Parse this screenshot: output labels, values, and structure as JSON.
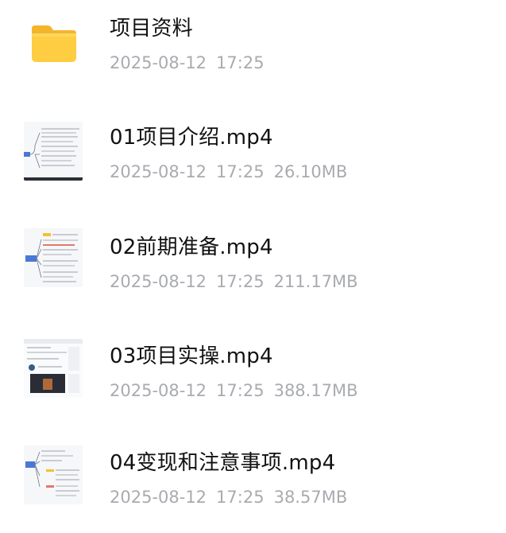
{
  "files": [
    {
      "name": "项目资料",
      "date": "2025-08-12",
      "time": "17:25",
      "size": "",
      "type": "folder",
      "icon": "folder-icon"
    },
    {
      "name": "01项目介绍.mp4",
      "date": "2025-08-12",
      "time": "17:25",
      "size": "26.10MB",
      "type": "video",
      "icon": "video-thumbnail"
    },
    {
      "name": "02前期准备.mp4",
      "date": "2025-08-12",
      "time": "17:25",
      "size": "211.17MB",
      "type": "video",
      "icon": "video-thumbnail"
    },
    {
      "name": "03项目实操.mp4",
      "date": "2025-08-12",
      "time": "17:25",
      "size": "388.17MB",
      "type": "video",
      "icon": "video-thumbnail"
    },
    {
      "name": "04变现和注意事项.mp4",
      "date": "2025-08-12",
      "time": "17:25",
      "size": "38.57MB",
      "type": "video",
      "icon": "video-thumbnail"
    }
  ],
  "colors": {
    "folder": "#ffcb3d",
    "name_text": "#111111",
    "meta_text": "#a9abb0"
  }
}
